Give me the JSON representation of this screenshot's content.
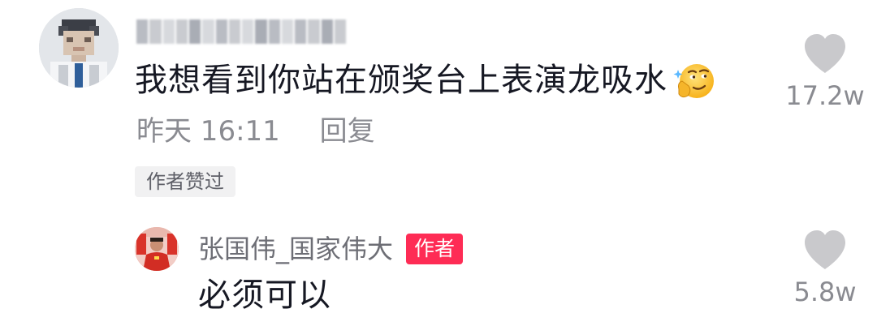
{
  "comment": {
    "text": "我想看到你站在颁奖台上表演龙吸水",
    "emoji_icon": "smirk-face-emoji",
    "timestamp": "昨天 16:11",
    "reply_label": "回复",
    "author_liked_tag": "作者赞过",
    "like_count": "17.2w",
    "like_icon": "heart-icon"
  },
  "reply": {
    "author_name": "张国伟_国家伟大",
    "author_badge": "作者",
    "text": "必须可以",
    "like_count": "5.8w",
    "like_icon": "heart-icon"
  },
  "colors": {
    "text_primary": "#161823",
    "text_secondary": "#8a8b91",
    "heart": "#c9c9cc",
    "badge_bg": "#fe2c55",
    "tag_bg": "#f1f1f2"
  }
}
